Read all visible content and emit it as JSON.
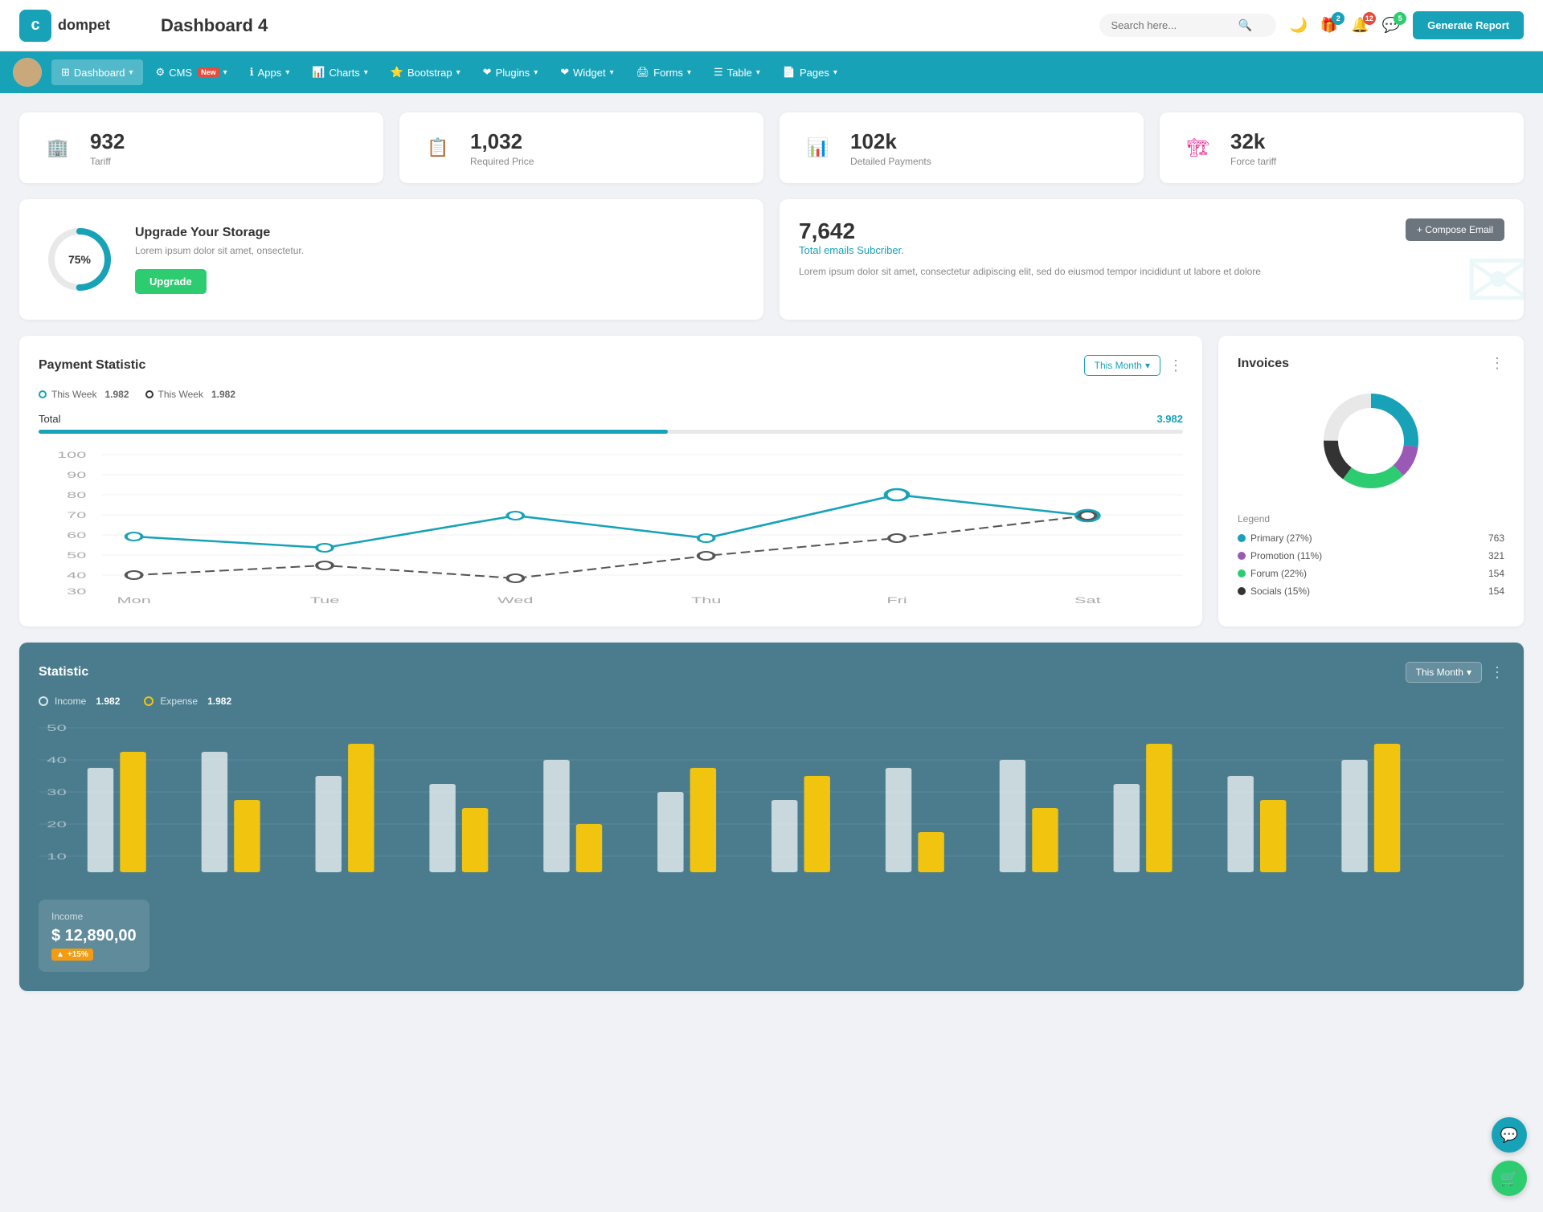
{
  "topbar": {
    "logo_text": "dompet",
    "page_title": "Dashboard 4",
    "search_placeholder": "Search here...",
    "search_icon": "🔍",
    "dark_mode_icon": "🌙",
    "gift_icon": "🎁",
    "notification_icon": "🔔",
    "chat_icon": "💬",
    "gift_badge": "2",
    "notification_badge": "12",
    "chat_badge": "5",
    "generate_btn": "Generate Report"
  },
  "navbar": {
    "items": [
      {
        "id": "dashboard",
        "label": "Dashboard",
        "icon": "⊞",
        "active": true,
        "has_arrow": true
      },
      {
        "id": "cms",
        "label": "CMS",
        "icon": "⚙",
        "active": false,
        "has_arrow": true,
        "badge": "New"
      },
      {
        "id": "apps",
        "label": "Apps",
        "icon": "ℹ",
        "active": false,
        "has_arrow": true
      },
      {
        "id": "charts",
        "label": "Charts",
        "icon": "📊",
        "active": false,
        "has_arrow": true
      },
      {
        "id": "bootstrap",
        "label": "Bootstrap",
        "icon": "⭐",
        "active": false,
        "has_arrow": true
      },
      {
        "id": "plugins",
        "label": "Plugins",
        "icon": "❤",
        "active": false,
        "has_arrow": true
      },
      {
        "id": "widget",
        "label": "Widget",
        "icon": "❤",
        "active": false,
        "has_arrow": true
      },
      {
        "id": "forms",
        "label": "Forms",
        "icon": "🖨",
        "active": false,
        "has_arrow": true
      },
      {
        "id": "table",
        "label": "Table",
        "icon": "☰",
        "active": false,
        "has_arrow": true
      },
      {
        "id": "pages",
        "label": "Pages",
        "icon": "📄",
        "active": false,
        "has_arrow": true
      }
    ]
  },
  "stat_cards": [
    {
      "id": "tariff",
      "value": "932",
      "label": "Tariff",
      "icon": "🏢",
      "icon_class": "icon-teal"
    },
    {
      "id": "required_price",
      "value": "1,032",
      "label": "Required Price",
      "icon": "📋",
      "icon_class": "icon-red"
    },
    {
      "id": "detailed_payments",
      "value": "102k",
      "label": "Detailed Payments",
      "icon": "📊",
      "icon_class": "icon-purple"
    },
    {
      "id": "force_tariff",
      "value": "32k",
      "label": "Force tariff",
      "icon": "🏗",
      "icon_class": "icon-pink"
    }
  ],
  "storage": {
    "percent": "75%",
    "title": "Upgrade Your Storage",
    "description": "Lorem ipsum dolor sit amet, onsectetur.",
    "btn_label": "Upgrade",
    "percent_num": 75
  },
  "email": {
    "stat": "7,642",
    "subtitle": "Total emails Subcriber.",
    "description": "Lorem ipsum dolor sit amet, consectetur adipiscing elit, sed do eiusmod tempor incididunt ut labore et dolore",
    "compose_btn": "+ Compose Email"
  },
  "payment": {
    "title": "Payment Statistic",
    "month_btn": "This Month",
    "legend": [
      {
        "label": "This Week",
        "value": "1.982",
        "color": "#17a2b8"
      },
      {
        "label": "This Week",
        "value": "1.982",
        "color": "#333"
      }
    ],
    "total_label": "Total",
    "total_value": "3.982",
    "y_labels": [
      "100",
      "90",
      "80",
      "70",
      "60",
      "50",
      "40",
      "30"
    ],
    "x_labels": [
      "Mon",
      "Tue",
      "Wed",
      "Thu",
      "Fri",
      "Sat"
    ]
  },
  "invoices": {
    "title": "Invoices",
    "legend": [
      {
        "label": "Primary (27%)",
        "value": "763",
        "color": "#17a2b8"
      },
      {
        "label": "Promotion (11%)",
        "value": "321",
        "color": "#9b59b6"
      },
      {
        "label": "Forum (22%)",
        "value": "154",
        "color": "#2ecc71"
      },
      {
        "label": "Socials (15%)",
        "value": "154",
        "color": "#333"
      }
    ],
    "legend_title": "Legend"
  },
  "statistic": {
    "title": "Statistic",
    "month_btn": "This Month",
    "income_label": "Income",
    "income_value": "1.982",
    "expense_label": "Expense",
    "expense_value": "1.982",
    "income_panel": {
      "title": "Income",
      "value": "$ 12,890,00",
      "badge": "+15%"
    },
    "y_labels": [
      "50",
      "40",
      "30",
      "20",
      "10"
    ]
  },
  "month_dropdown": "Month"
}
